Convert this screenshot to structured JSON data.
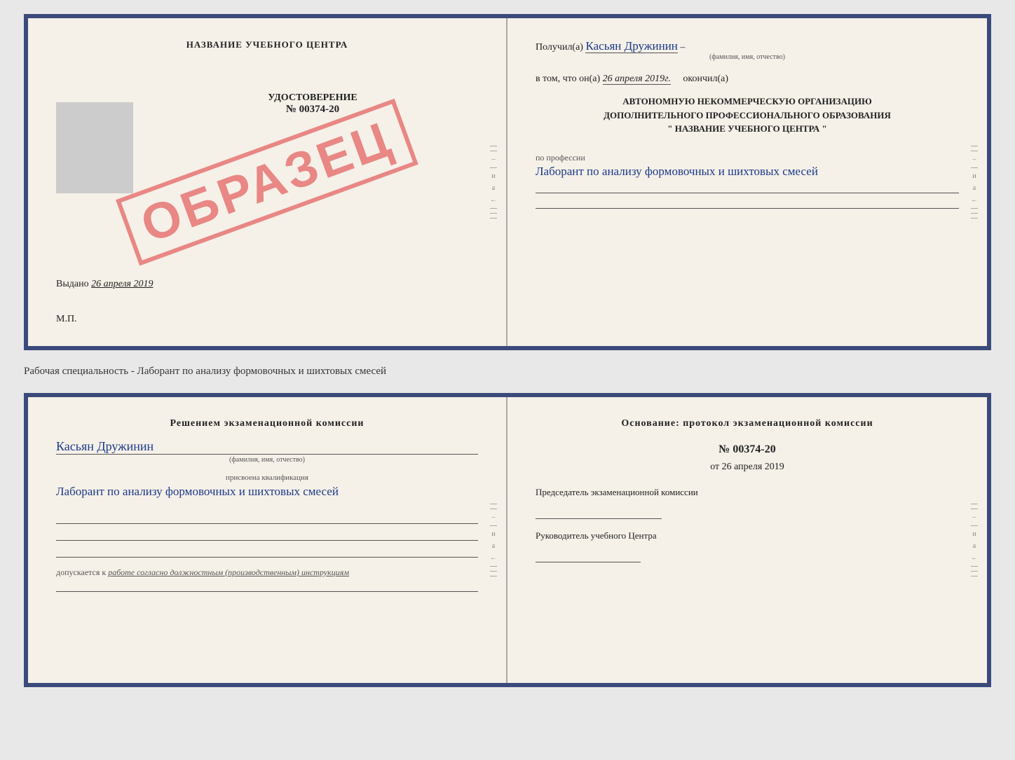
{
  "top_card": {
    "left": {
      "title": "НАЗВАНИЕ УЧЕБНОГО ЦЕНТРА",
      "photo_placeholder": "",
      "cert_label": "УДОСТОВЕРЕНИЕ",
      "cert_number": "№ 00374-20",
      "issued_label": "Выдано",
      "issued_date": "26 апреля 2019",
      "mp_label": "М.П.",
      "sample_stamp": "ОБРАЗЕЦ"
    },
    "right": {
      "received_prefix": "Получил(а)",
      "received_name": "Касьян Дружинин",
      "name_hint": "(фамилия, имя, отчество)",
      "date_prefix": "в том, что он(а)",
      "date_value": "26 апреля 2019г.",
      "date_suffix": "окончил(а)",
      "org_line1": "АВТОНОМНУЮ НЕКОММЕРЧЕСКУЮ ОРГАНИЗАЦИЮ",
      "org_line2": "ДОПОЛНИТЕЛЬНОГО ПРОФЕССИОНАЛЬНОГО ОБРАЗОВАНИЯ",
      "org_line3": "\"  НАЗВАНИЕ УЧЕБНОГО ЦЕНТРА  \"",
      "profession_label": "по профессии",
      "profession_value": "Лаборант по анализу формовочных и шихтовых смесей"
    }
  },
  "description": "Рабочая специальность - Лаборант по анализу формовочных и шихтовых смесей",
  "bottom_card": {
    "left": {
      "decision_title": "Решением экзаменационной комиссии",
      "person_name": "Касьян Дружинин",
      "name_hint": "(фамилия, имя, отчество)",
      "qualification_label": "присвоена квалификация",
      "qualification_value": "Лаборант по анализу формовочных и шихтовых смесей",
      "allow_prefix": "допускается к",
      "allow_value": "работе согласно должностным (производственным) инструкциям"
    },
    "right": {
      "basis_title": "Основание: протокол экзаменационной комиссии",
      "protocol_num": "№ 00374-20",
      "protocol_date_prefix": "от",
      "protocol_date": "26 апреля 2019",
      "chairman_label": "Председатель экзаменационной комиссии",
      "director_label": "Руководитель учебного Центра"
    }
  },
  "colors": {
    "border": "#3a4a7a",
    "handwriting": "#1a3a8a",
    "stamp_red": "rgba(220,50,50,0.55)",
    "text_dark": "#222",
    "text_muted": "#555"
  }
}
